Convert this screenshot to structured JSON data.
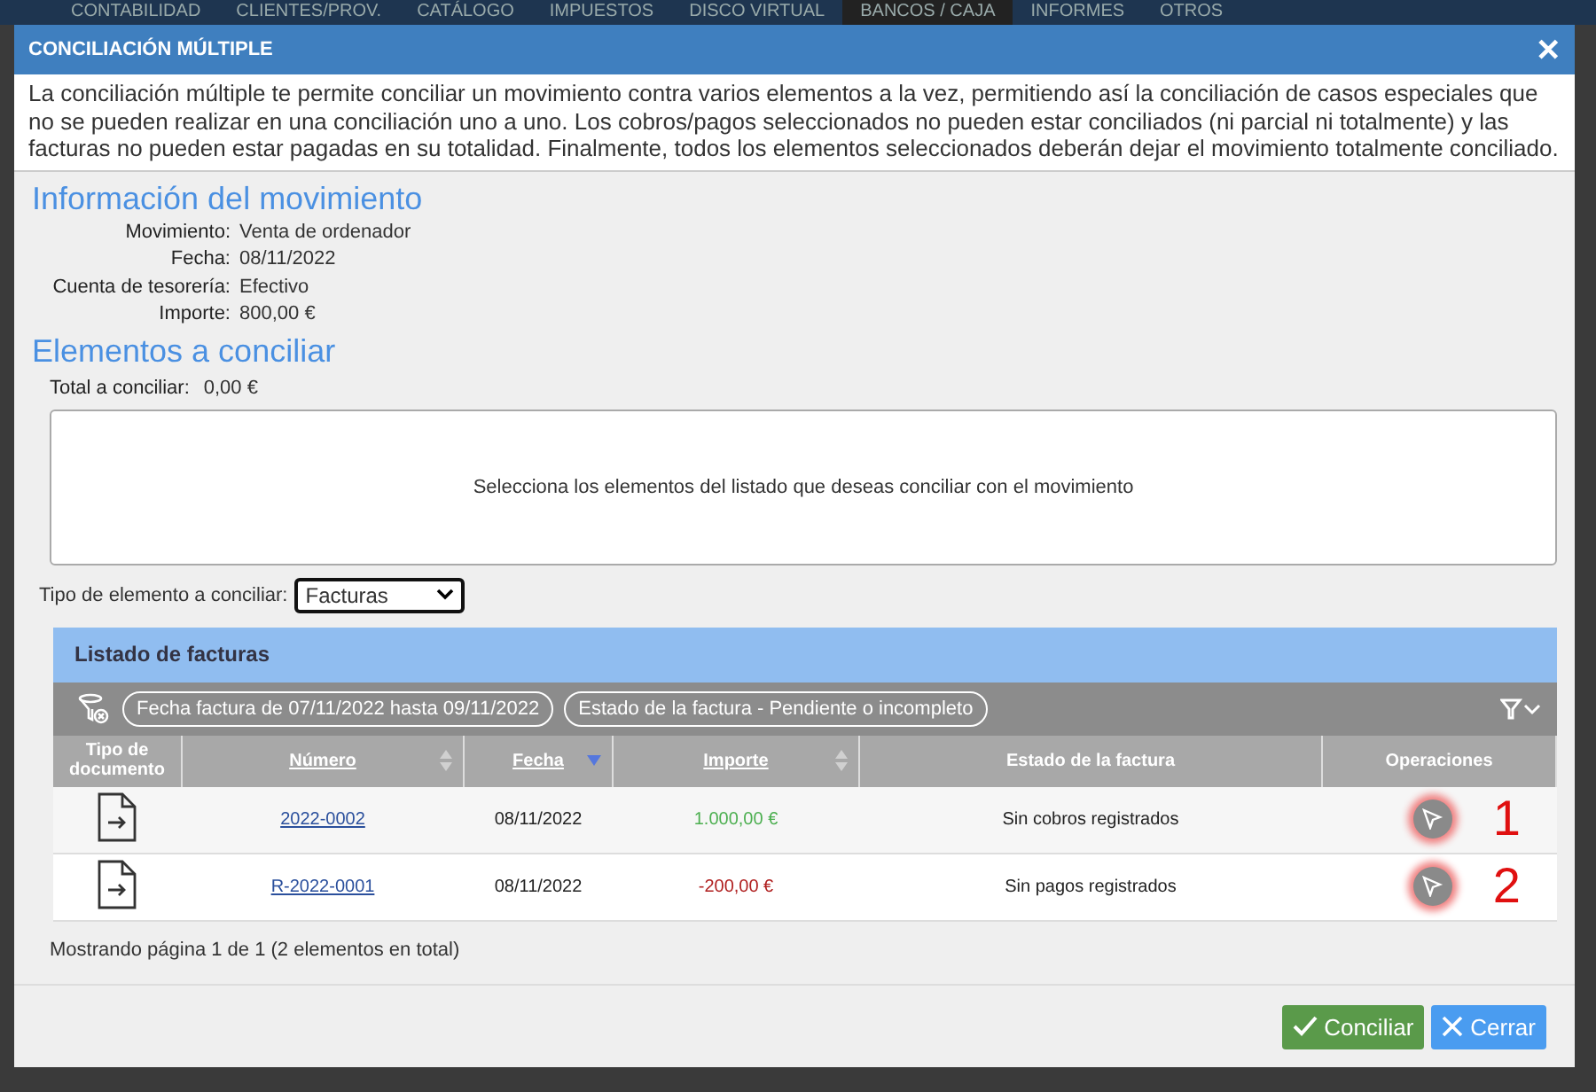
{
  "top_menu": [
    {
      "label": "CONTABILIDAD",
      "selected": false
    },
    {
      "label": "CLIENTES/PROV.",
      "selected": false
    },
    {
      "label": "CATÁLOGO",
      "selected": false
    },
    {
      "label": "IMPUESTOS",
      "selected": false
    },
    {
      "label": "DISCO VIRTUAL",
      "selected": false
    },
    {
      "label": "BANCOS / CAJA",
      "selected": true
    },
    {
      "label": "INFORMES",
      "selected": false
    },
    {
      "label": "OTROS",
      "selected": false
    }
  ],
  "dialog": {
    "title": "CONCILIACIÓN MÚLTIPLE",
    "close": "✕",
    "description": "La conciliación múltiple te permite conciliar un movimiento contra varios elementos a la vez, permitiendo así la conciliación de casos especiales que no se pueden realizar en una conciliación uno a uno. Los cobros/pagos seleccionados no pueden estar conciliados (ni parcial ni totalmente) y las facturas no pueden estar pagadas en su totalidad. Finalmente, todos los elementos seleccionados deberán dejar el movimiento totalmente conciliado.",
    "movement_heading": "Información del movimiento",
    "movement_fields": [
      {
        "label": "Movimiento:",
        "value": "Venta de ordenador"
      },
      {
        "label": "Fecha:",
        "value": "08/11/2022"
      },
      {
        "label": "Cuenta de tesorería:",
        "value": "Efectivo"
      },
      {
        "label": "Importe:",
        "value": "800,00 €"
      }
    ],
    "elements_heading": "Elementos a conciliar",
    "total": {
      "label": "Total a conciliar:",
      "value": "0,00 €"
    },
    "selection_hint": "Selecciona los elementos del listado que deseas conciliar con el movimiento",
    "type_select": {
      "label": "Tipo de elemento a conciliar:",
      "value": "Facturas"
    },
    "list": {
      "title": "Listado de facturas",
      "filters": [
        "Fecha factura de 07/11/2022 hasta 09/11/2022",
        "Estado de la factura - Pendiente o incompleto"
      ],
      "columns": [
        {
          "label": "Tipo de documento",
          "sortable": false
        },
        {
          "label": "Número",
          "sortable": true,
          "sorted": false
        },
        {
          "label": "Fecha",
          "sortable": true,
          "sorted": true
        },
        {
          "label": "Importe",
          "sortable": true,
          "sorted": false
        },
        {
          "label": "Estado de la factura",
          "sortable": false
        },
        {
          "label": "Operaciones",
          "sortable": false
        }
      ],
      "rows": [
        {
          "number": "2022-0002",
          "date": "08/11/2022",
          "amount": "1.000,00 €",
          "negative": false,
          "status": "Sin cobros registrados",
          "marker": "1"
        },
        {
          "number": "R-2022-0001",
          "date": "08/11/2022",
          "amount": "-200,00 €",
          "negative": true,
          "status": "Sin pagos registrados",
          "marker": "2"
        }
      ],
      "pagination": "Mostrando página 1 de 1 (2 elementos en total)"
    },
    "buttons": [
      {
        "kind": "confirm",
        "label": "Conciliar"
      },
      {
        "kind": "cancel",
        "label": "Cerrar"
      }
    ]
  }
}
